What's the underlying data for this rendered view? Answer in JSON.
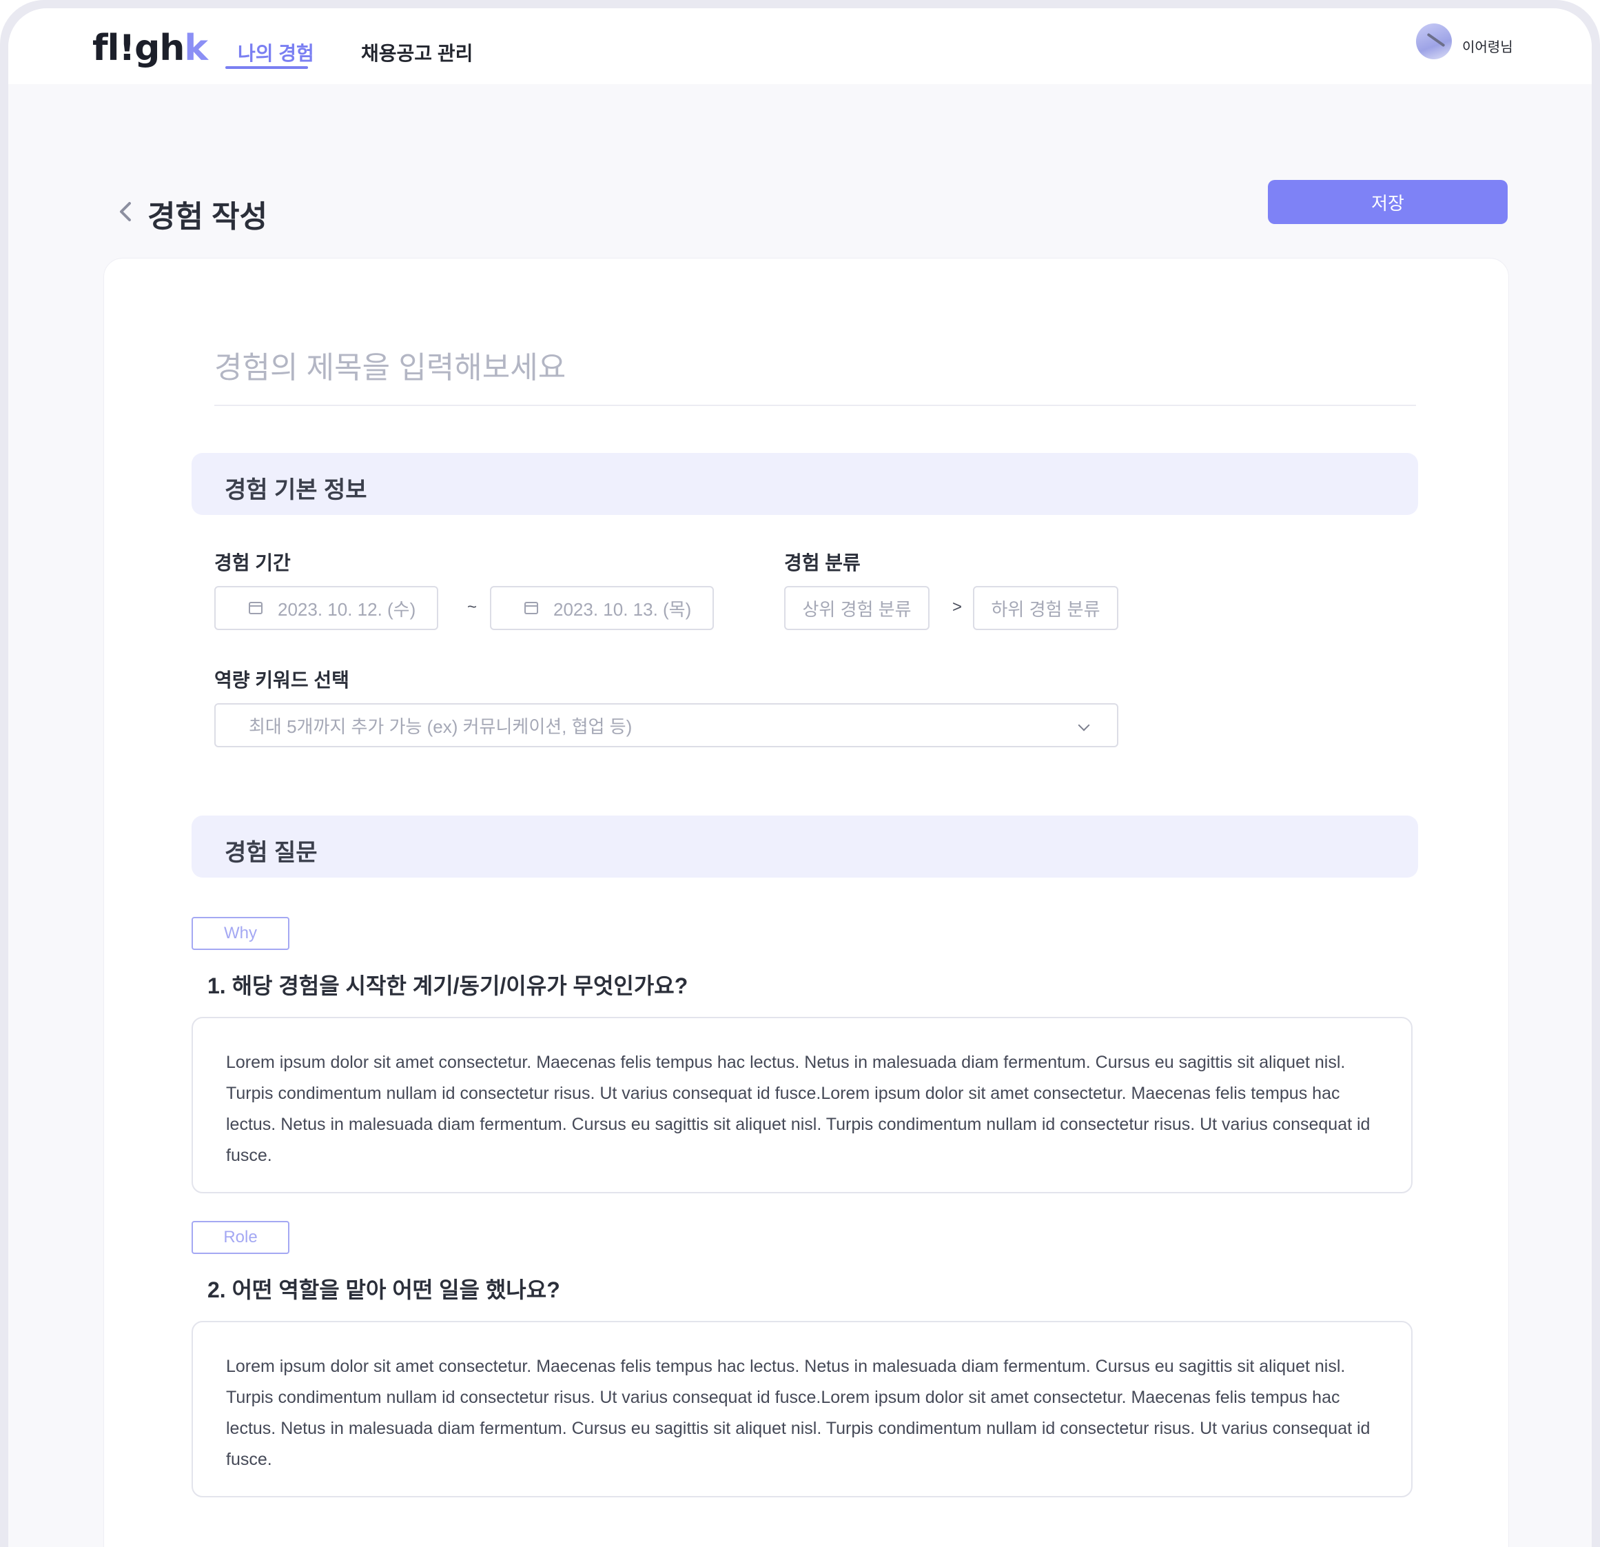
{
  "header": {
    "logo_main": "fl!gh",
    "logo_accent": "k",
    "nav": [
      {
        "label": "나의 경험",
        "active": true
      },
      {
        "label": "채용공고 관리",
        "active": false
      }
    ],
    "user_name": "이어령님"
  },
  "page": {
    "title": "경험 작성",
    "save_label": "저장"
  },
  "form": {
    "title_placeholder": "경험의 제목을 입력해보세요",
    "basic_section": "경험 기본 정보",
    "period_label": "경험 기간",
    "start_date": "2023. 10. 12. (수)",
    "range_sep": "~",
    "end_date": "2023. 10. 13. (목)",
    "category_label": "경험 분류",
    "upper_category": "상위 경험 분류",
    "category_sep": ">",
    "lower_category": "하위 경험 분류",
    "keyword_label": "역량 키워드 선택",
    "keyword_placeholder": "최대 5개까지 추가 가능 (ex) 커뮤니케이션, 협업 등)",
    "question_section": "경험 질문",
    "questions": [
      {
        "tag": "Why",
        "text": "1. 해당 경험을 시작한 계기/동기/이유가 무엇인가요?",
        "answer": "Lorem ipsum dolor sit amet consectetur. Maecenas felis tempus hac lectus. Netus in malesuada diam fermentum. Cursus eu sagittis sit aliquet nisl. Turpis condimentum nullam id consectetur risus. Ut varius consequat id fusce.Lorem ipsum dolor sit amet consectetur. Maecenas felis tempus hac lectus. Netus in malesuada diam fermentum. Cursus eu sagittis sit aliquet nisl. Turpis condimentum nullam id consectetur risus. Ut varius consequat id fusce."
      },
      {
        "tag": "Role",
        "text": "2. 어떤 역할을 맡아 어떤 일을 했나요?",
        "answer": "Lorem ipsum dolor sit amet consectetur. Maecenas felis tempus hac lectus. Netus in malesuada diam fermentum. Cursus eu sagittis sit aliquet nisl. Turpis condimentum nullam id consectetur risus. Ut varius consequat id fusce.Lorem ipsum dolor sit amet consectetur. Maecenas felis tempus hac lectus. Netus in malesuada diam fermentum. Cursus eu sagittis sit aliquet nisl. Turpis condimentum nullam id consectetur risus. Ut varius consequat id fusce."
      }
    ]
  },
  "icons": {
    "back": "chevron-left-icon",
    "calendar": "calendar-icon",
    "dropdown": "chevron-down-icon",
    "avatar": "avatar-image"
  },
  "colors": {
    "accent": "#7e82f6",
    "section_bg": "#eff0fd",
    "page_bg": "#f8f8fb"
  }
}
